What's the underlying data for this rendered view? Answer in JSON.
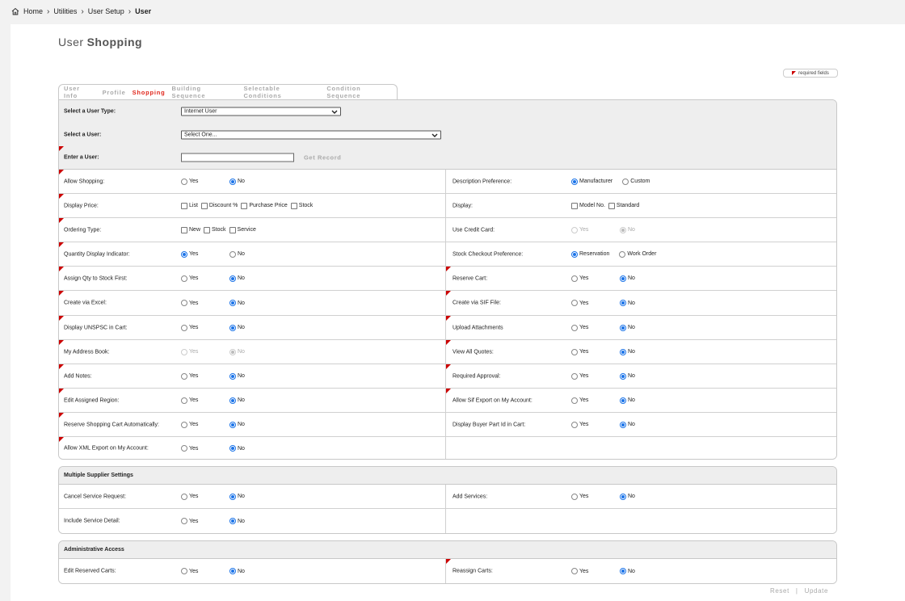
{
  "breadcrumb": [
    {
      "label": "Home"
    },
    {
      "label": "Utilities"
    },
    {
      "label": "User Setup"
    },
    {
      "label": "User"
    }
  ],
  "title": {
    "prefix": "User",
    "main": "Shopping"
  },
  "required_label": "required fields",
  "tabs": [
    "User Info",
    "Profile",
    "Shopping",
    "Building Sequence",
    "Selectable Conditions",
    "Condition Sequence"
  ],
  "active_tab": "Shopping",
  "top_fields": {
    "user_type": {
      "label": "Select a User Type:",
      "value": "Internet User"
    },
    "user": {
      "label": "Select a User:",
      "value": "Select One..."
    },
    "enter_user": {
      "label": "Enter a User:",
      "value": "",
      "button": "Get Record"
    }
  },
  "rows": [
    {
      "left": {
        "label": "Allow Shopping:",
        "type": "radio",
        "options": [
          "Yes",
          "No"
        ],
        "selected": "No",
        "flag": true
      },
      "right": {
        "label": "Description Preference:",
        "type": "radio",
        "options": [
          "Manufacturer",
          "Custom"
        ],
        "selected": "Manufacturer",
        "flag": false
      }
    },
    {
      "left": {
        "label": "Display Price:",
        "type": "checkbox",
        "options": [
          "List",
          "Discount %",
          "Purchase Price",
          "Stock"
        ],
        "flag": true
      },
      "right": {
        "label": "Display:",
        "type": "checkbox",
        "options": [
          "Model No.",
          "Standard"
        ],
        "flag": false
      }
    },
    {
      "left": {
        "label": "Ordering Type:",
        "type": "checkbox",
        "options": [
          "New",
          "Stock",
          "Service"
        ],
        "flag": true
      },
      "right": {
        "label": "Use Credit Card:",
        "type": "radio",
        "options": [
          "Yes",
          "No"
        ],
        "selected": "No",
        "disabled": true,
        "flag": false
      }
    },
    {
      "left": {
        "label": "Quantity Display Indicator:",
        "type": "radio",
        "options": [
          "Yes",
          "No"
        ],
        "selected": "Yes",
        "flag": true
      },
      "right": {
        "label": "Stock Checkout Preference:",
        "type": "radio",
        "options": [
          "Reservation",
          "Work Order"
        ],
        "selected": "Reservation",
        "flag": false
      }
    },
    {
      "left": {
        "label": "Assign Qty to Stock First:",
        "type": "radio",
        "options": [
          "Yes",
          "No"
        ],
        "selected": "No",
        "flag": true
      },
      "right": {
        "label": "Reserve Cart:",
        "type": "radio",
        "options": [
          "Yes",
          "No"
        ],
        "selected": "No",
        "flag": true
      }
    },
    {
      "left": {
        "label": "Create via Excel:",
        "type": "radio",
        "options": [
          "Yes",
          "No"
        ],
        "selected": "No",
        "flag": true
      },
      "right": {
        "label": "Create via SIF File:",
        "type": "radio",
        "options": [
          "Yes",
          "No"
        ],
        "selected": "No",
        "flag": true
      }
    },
    {
      "left": {
        "label": "Display UNSPSC in Cart:",
        "type": "radio",
        "options": [
          "Yes",
          "No"
        ],
        "selected": "No",
        "flag": true
      },
      "right": {
        "label": "Upload Attachments",
        "type": "radio",
        "options": [
          "Yes",
          "No"
        ],
        "selected": "No",
        "flag": true
      }
    },
    {
      "left": {
        "label": "My Address Book:",
        "type": "radio",
        "options": [
          "Yes",
          "No"
        ],
        "selected": "No",
        "disabled": true,
        "flag": true
      },
      "right": {
        "label": "View All Quotes:",
        "type": "radio",
        "options": [
          "Yes",
          "No"
        ],
        "selected": "No",
        "flag": true
      }
    },
    {
      "left": {
        "label": "Add Notes:",
        "type": "radio",
        "options": [
          "Yes",
          "No"
        ],
        "selected": "No",
        "flag": true
      },
      "right": {
        "label": "Required Approval:",
        "type": "radio",
        "options": [
          "Yes",
          "No"
        ],
        "selected": "No",
        "flag": true
      }
    },
    {
      "left": {
        "label": "Edit Assigned Region:",
        "type": "radio",
        "options": [
          "Yes",
          "No"
        ],
        "selected": "No",
        "flag": true
      },
      "right": {
        "label": "Allow Sif Export on My Account:",
        "type": "radio",
        "options": [
          "Yes",
          "No"
        ],
        "selected": "No",
        "flag": true
      }
    },
    {
      "left": {
        "label": "Reserve Shopping Cart Automatically:",
        "type": "radio",
        "options": [
          "Yes",
          "No"
        ],
        "selected": "No",
        "flag": true
      },
      "right": {
        "label": "Display Buyer Part Id in Cart:",
        "type": "radio",
        "options": [
          "Yes",
          "No"
        ],
        "selected": "No",
        "flag": false
      }
    },
    {
      "left": {
        "label": "Allow XML Export on My Account:",
        "type": "radio",
        "options": [
          "Yes",
          "No"
        ],
        "selected": "No",
        "flag": true
      },
      "right": null
    }
  ],
  "multi_supplier": {
    "title": "Multiple Supplier Settings",
    "rows": [
      {
        "left": {
          "label": "Cancel Service Request:",
          "type": "radio",
          "options": [
            "Yes",
            "No"
          ],
          "selected": "No",
          "flag": false
        },
        "right": {
          "label": "Add Services:",
          "type": "radio",
          "options": [
            "Yes",
            "No"
          ],
          "selected": "No",
          "flag": false
        }
      },
      {
        "left": {
          "label": "Include Service Detail:",
          "type": "radio",
          "options": [
            "Yes",
            "No"
          ],
          "selected": "No",
          "flag": false
        },
        "right": null
      }
    ]
  },
  "admin": {
    "title": "Administrative Access",
    "rows": [
      {
        "left": {
          "label": "Edit Reserved Carts:",
          "type": "radio",
          "options": [
            "Yes",
            "No"
          ],
          "selected": "No",
          "flag": false
        },
        "right": {
          "label": "Reassign Carts:",
          "type": "radio",
          "options": [
            "Yes",
            "No"
          ],
          "selected": "No",
          "flag": true
        }
      }
    ]
  },
  "footer": {
    "reset": "Reset",
    "separator": "|",
    "update": "Update"
  },
  "colors": {
    "accent": "#e0261b",
    "radio_selected": "#1a73e8",
    "flag": "#cc0000"
  }
}
